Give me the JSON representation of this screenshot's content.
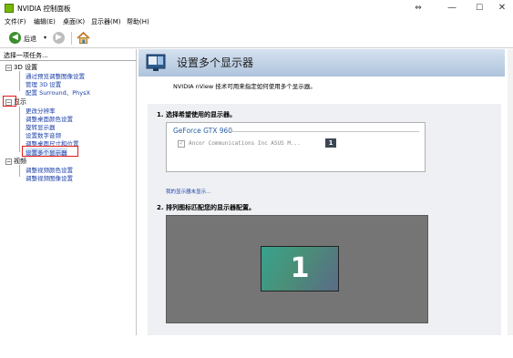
{
  "window": {
    "title": "NVIDIA 控制面板",
    "controls": {
      "resize": "⇔",
      "minimize": "—",
      "maximize": "☐",
      "close": "✕"
    }
  },
  "menu": [
    {
      "label": "文件(F)"
    },
    {
      "label": "编辑(E)"
    },
    {
      "label": "桌面(K)"
    },
    {
      "label": "显示器(M)"
    },
    {
      "label": "帮助(H)"
    }
  ],
  "toolbar": {
    "back_label": "后退",
    "back_icon": "◀",
    "dropdown_icon": "▾",
    "forward_icon": "▶"
  },
  "sidebar": {
    "header": "选择一项任务...",
    "categories": [
      {
        "label": "3D 设置",
        "toggle": "⊟",
        "items": [
          {
            "label": "通过预览调整图像设置"
          },
          {
            "label": "管理 3D 设置"
          },
          {
            "label": "配置 Surround、PhysX"
          }
        ]
      },
      {
        "label": "显示",
        "toggle": "⊟",
        "items": [
          {
            "label": "更改分辨率"
          },
          {
            "label": "调整桌面颜色设置"
          },
          {
            "label": "旋转显示器"
          },
          {
            "label": "设置数字音频"
          },
          {
            "label": "调整桌面尺寸和位置"
          },
          {
            "label": "设置多个显示器"
          }
        ]
      },
      {
        "label": "视频",
        "toggle": "⊟",
        "items": [
          {
            "label": "调整视频颜色设置"
          },
          {
            "label": "调整视频图像设置"
          }
        ]
      }
    ]
  },
  "content": {
    "title": "设置多个显示器",
    "intro": "NVIDIA nView 技术可用来指定如何使用多个显示器。",
    "step1": "1. 选择希望使用的显示器。",
    "gpu_name": "GeForce GTX 960",
    "monitor_name": "Ancor Communications Inc ASUS M...",
    "monitor_number": "1",
    "check_mark": "✓",
    "help_link": "我的显示器未显示...",
    "step2": "2. 排列图标匹配您的显示器配置。",
    "tile_number": "1"
  },
  "colors": {
    "nvidia_green": "#76b900",
    "link_blue": "#1a3ea8",
    "highlight_red": "#e11a1a",
    "arrange_bg": "#757575"
  }
}
